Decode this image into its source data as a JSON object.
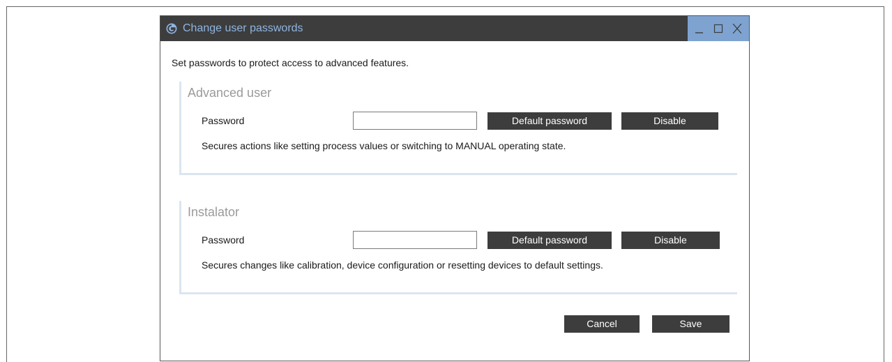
{
  "window": {
    "title": "Change user passwords",
    "accent_color": "#7ea3d1",
    "titlebar_color": "#3d3d3d",
    "title_color": "#8fb4e0",
    "controls": [
      "minimize-icon",
      "maximize-icon",
      "close-icon"
    ]
  },
  "description": "Set passwords to protect access to advanced features.",
  "sections": [
    {
      "title": "Advanced user",
      "password_label": "Password",
      "password_value": "",
      "default_button": "Default password",
      "disable_button": "Disable",
      "description": "Secures actions like setting process values or switching to MANUAL operating state."
    },
    {
      "title": "Instalator",
      "password_label": "Password",
      "password_value": "",
      "default_button": "Default password",
      "disable_button": "Disable",
      "description": "Secures changes like calibration, device configuration or resetting devices to default settings."
    }
  ],
  "footer": {
    "cancel_label": "Cancel",
    "save_label": "Save"
  }
}
